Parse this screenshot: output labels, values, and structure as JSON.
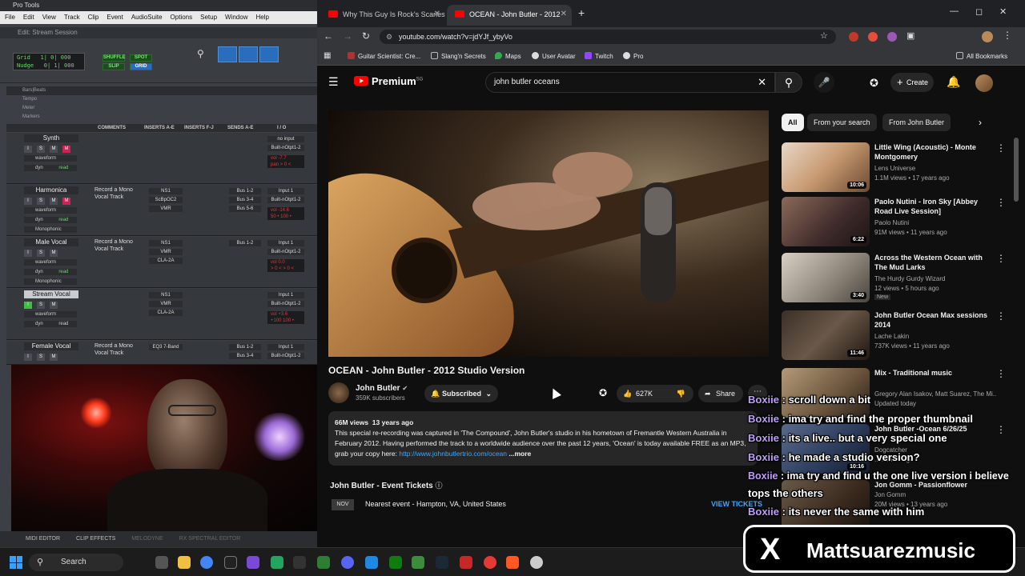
{
  "protools": {
    "title": "Pro Tools",
    "menu": [
      "File",
      "Edit",
      "View",
      "Track",
      "Clip",
      "Event",
      "AudioSuite",
      "Options",
      "Setup",
      "Window",
      "Help"
    ],
    "edit_window_title": "Edit: Stream Session",
    "mode_grid": "Grid",
    "mode_nudge": "Nudge",
    "grid_value": "1| 0| 000",
    "nudge_value": "0| 1| 000",
    "mode_shuffle": "SHUFFLE",
    "mode_spot": "SPOT",
    "mode_slip": "SLIP",
    "mode_grid2": "GRID",
    "rulers": [
      "Bars|Beats",
      "Tempo",
      "Meter",
      "Markers"
    ],
    "columns": {
      "comments": "COMMENTS",
      "inserts_ae": "INSERTS A-E",
      "inserts_fj": "INSERTS F-J",
      "sends_ae": "SENDS A-E",
      "io": "I / O"
    },
    "tracks": [
      {
        "name": "Synth",
        "view": "waveform",
        "auto": "dyn",
        "auto_mode": "read",
        "comment": "",
        "inserts": [
          "",
          "",
          ""
        ],
        "sends": [
          "",
          "",
          ""
        ],
        "io_in": "no input",
        "io_out": "Built-nOtpt1-2",
        "vol": "vol  -7.7",
        "pan": "pan  > 0 <",
        "mono": ""
      },
      {
        "name": "Harmonica",
        "view": "waveform",
        "auto": "dyn",
        "auto_mode": "read",
        "comment": "Record a Mono Vocal Track",
        "inserts": [
          "NS1",
          "ScBpOC2",
          "VMR"
        ],
        "sends": [
          "Bus 1-2",
          "Bus 3-4",
          "Bus 5-6"
        ],
        "io_in": "Input 1",
        "io_out": "Built-nOtpt1-2",
        "vol": "vol  -14.6",
        "pan": "50 •  100 •",
        "mono": "Monophonic"
      },
      {
        "name": "Male Vocal",
        "view": "waveform",
        "auto": "dyn",
        "auto_mode": "read",
        "comment": "Record a Mono Vocal Track",
        "inserts": [
          "NS1",
          "VMR",
          "CLA-2A"
        ],
        "sends": [
          "Bus 1-2",
          "",
          ""
        ],
        "io_in": "Input 1",
        "io_out": "Built-nOtpt1-2",
        "vol": "vol  0.0",
        "pan": "> 0 <  > 0 <",
        "mono": "Monophonic"
      },
      {
        "name": "Stream Vocal",
        "view": "waveform",
        "auto": "dyn",
        "auto_mode": "read",
        "comment": "",
        "inserts": [
          "NS1",
          "VMR",
          "CLA-2A"
        ],
        "sends": [
          "",
          "",
          ""
        ],
        "io_in": "Input 1",
        "io_out": "Built-nOtpt1-2",
        "vol": "vol  +3.6",
        "pan": "+100  100 •",
        "mono": ""
      },
      {
        "name": "Female Vocal",
        "view": "",
        "auto": "",
        "auto_mode": "",
        "comment": "Record a Mono Vocal Track",
        "inserts": [
          "EQ3 7-Band",
          "",
          ""
        ],
        "sends": [
          "Bus 1-2",
          "Bus 3-4",
          ""
        ],
        "io_in": "Input 1",
        "io_out": "Built-nOtpt1-2",
        "vol": "",
        "pan": "",
        "mono": ""
      }
    ],
    "bottom_tabs": [
      "MIDI EDITOR",
      "CLIP EFFECTS",
      "MELODYNE",
      "RX SPECTRAL EDITOR"
    ]
  },
  "browser": {
    "tabs": [
      {
        "title": "Why This Guy Is Rock's Scariest",
        "active": false
      },
      {
        "title": "OCEAN - John Butler - 2012",
        "active": true
      }
    ],
    "url": "youtube.com/watch?v=jdYJf_ybyVo",
    "bookmarks": [
      "Guitar Scientist: Cre...",
      "Slang'n Secrets",
      "Maps",
      "User Avatar",
      "Twitch",
      "Pro"
    ],
    "all_bookmarks": "All Bookmarks"
  },
  "youtube": {
    "logo": "Premium",
    "logo_sup": "SG",
    "search_query": "john butler oceans",
    "create_label": "Create",
    "video_title": "OCEAN - John Butler - 2012 Studio Version",
    "channel": "John Butler",
    "subscribers": "359K subscribers",
    "subscribed_label": "Subscribed",
    "likes": "627K",
    "share_label": "Share",
    "views": "66M views",
    "age": "13 years ago",
    "description": "This special re-recording was captured in 'The Compound', John Butler's studio in his hometown of Fremantle Western Australia in February 2012. Having performed the track to a worldwide audience over the past 12 years, 'Ocean' is today available FREE as an MP3, grab your copy here:",
    "desc_link": "http://www.johnbutlertrio.com/ocean",
    "desc_more": "...more",
    "tickets_title": "John Butler - Event Tickets",
    "tickets_month": "NOV",
    "tickets_event": "Nearest event - Hampton, VA, United States",
    "tickets_button": "VIEW TICKETS",
    "chips": [
      "All",
      "From your search",
      "From John Butler"
    ],
    "recommendations": [
      {
        "title": "Little Wing (Acoustic) - Monte Montgomery",
        "channel": "Lens Universe",
        "meta": "1.1M views • 17 years ago",
        "duration": "10:06",
        "new": ""
      },
      {
        "title": "Paolo Nutini - Iron Sky [Abbey Road Live Session]",
        "channel": "Paolo Nutini",
        "meta": "91M views • 11 years ago",
        "duration": "6:22",
        "new": ""
      },
      {
        "title": "Across the Western Ocean with The Mud Larks",
        "channel": "The Hurdy Gurdy Wizard",
        "meta": "12 views • 5 hours ago",
        "duration": "3:40",
        "new": "New"
      },
      {
        "title": "John Butler Ocean Max sessions 2014",
        "channel": "Lache Lakin",
        "meta": "737K views • 11 years ago",
        "duration": "11:46",
        "new": ""
      },
      {
        "title": "Mix - Traditional music",
        "channel": "Gregory Alan Isakov, Matt Suarez, The Mi...",
        "meta": "Updated today",
        "duration": "",
        "new": ""
      },
      {
        "title": "John Butler -Ocean 6/26/25",
        "channel": "Dogcatcher",
        "meta": "...months ago",
        "duration": "10:16",
        "new": ""
      },
      {
        "title": "Jon Gomm - Passionflower",
        "channel": "Jon Gomm",
        "meta": "20M views • 13 years ago",
        "duration": "",
        "new": ""
      }
    ]
  },
  "chat": [
    {
      "user": "Boxiie",
      "text": " : scroll down a bit"
    },
    {
      "user": "Boxiie",
      "text": " : ima try and find the proper thumbnail"
    },
    {
      "user": "Boxiie",
      "text": " : its a live.. but a very special one"
    },
    {
      "user": "Boxiie",
      "text": " : he made a studio version?"
    },
    {
      "user": "Boxiie",
      "text": " : ima try and find u the one live version i believe"
    },
    {
      "user": "",
      "text": "tops the others"
    },
    {
      "user": "Boxiie",
      "text": " : its never the same with him"
    }
  ],
  "banner": {
    "logo": "X",
    "handle": "Mattsuarezmusic"
  },
  "taskbar": {
    "search": "Search"
  },
  "colors": {
    "yt_red": "#ff0000",
    "link_blue": "#3ea6ff",
    "chat_user": "#c09cff",
    "pt_green": "#6fd36f"
  }
}
